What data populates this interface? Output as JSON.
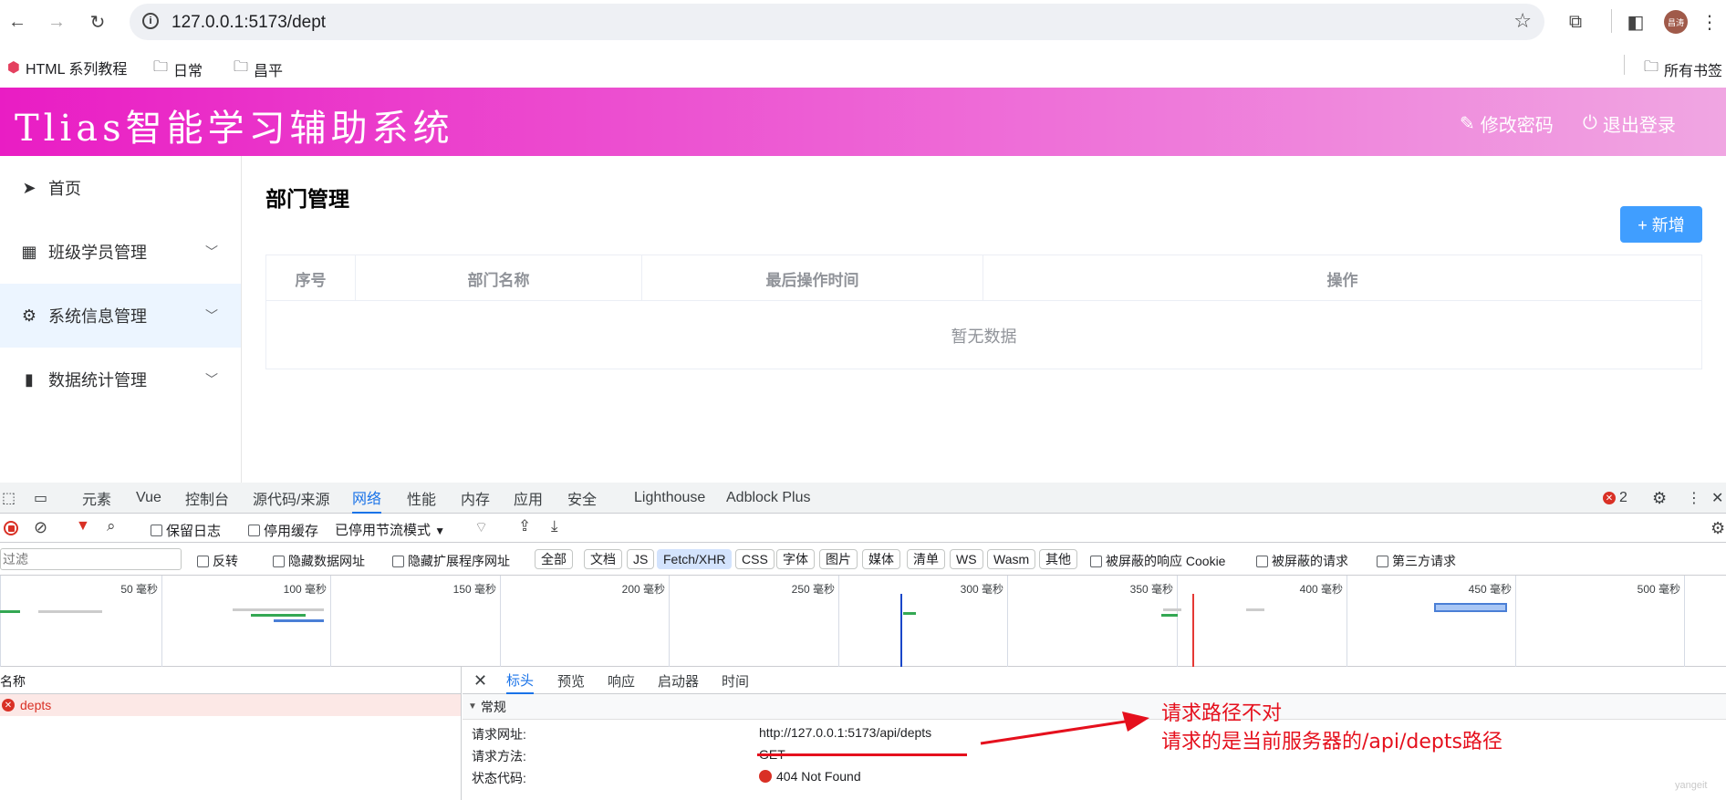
{
  "browser": {
    "url": "127.0.0.1:5173/dept",
    "bookmarks": [
      "HTML 系列教程",
      "日常",
      "昌平"
    ],
    "all_bookmarks": "所有书签",
    "avatar_text": "昌涛"
  },
  "app": {
    "title": "Tlias智能学习辅助系统",
    "change_password": "修改密码",
    "logout": "退出登录"
  },
  "sidebar": {
    "items": [
      {
        "label": "首页",
        "icon": "send-icon"
      },
      {
        "label": "班级学员管理",
        "icon": "grid-icon"
      },
      {
        "label": "系统信息管理",
        "icon": "gear-icon"
      },
      {
        "label": "数据统计管理",
        "icon": "bar-chart-icon"
      }
    ]
  },
  "main": {
    "page_title": "部门管理",
    "add_button": "+ 新增",
    "columns": [
      "序号",
      "部门名称",
      "最后操作时间",
      "操作"
    ],
    "empty_text": "暂无数据"
  },
  "devtools": {
    "tabs": [
      "元素",
      "Vue",
      "控制台",
      "源代码/来源",
      "网络",
      "性能",
      "内存",
      "应用",
      "安全",
      "Lighthouse",
      "Adblock Plus"
    ],
    "active_tab": "网络",
    "error_count": "2",
    "toolbar": {
      "preserve_log": "保留日志",
      "disable_cache": "停用缓存",
      "throttle": "已停用节流模式"
    },
    "filter": {
      "placeholder": "过滤",
      "invert": "反转",
      "hide_data_urls": "隐藏数据网址",
      "hide_ext_urls": "隐藏扩展程序网址",
      "types": [
        "全部",
        "文档",
        "JS",
        "Fetch/XHR",
        "CSS",
        "字体",
        "图片",
        "媒体",
        "清单",
        "WS",
        "Wasm",
        "其他"
      ],
      "active_type": "Fetch/XHR",
      "blocked_cookies": "被屏蔽的响应 Cookie",
      "blocked_requests": "被屏蔽的请求",
      "third_party": "第三方请求"
    },
    "timeline_ticks": [
      "50 毫秒",
      "100 毫秒",
      "150 毫秒",
      "200 毫秒",
      "250 毫秒",
      "300 毫秒",
      "350 毫秒",
      "400 毫秒",
      "450 毫秒",
      "500 毫秒"
    ],
    "list_header": "名称",
    "request_name": "depts",
    "detail_tabs": [
      "标头",
      "预览",
      "响应",
      "启动器",
      "时间"
    ],
    "section": "常规",
    "general": {
      "url_label": "请求网址:",
      "url_value": "http://127.0.0.1:5173/api/depts",
      "method_label": "请求方法:",
      "method_value": "GET",
      "status_label": "状态代码:",
      "status_value": "404 Not Found"
    }
  },
  "annotation": {
    "line1": "请求路径不对",
    "line2": "请求的是当前服务器的/api/depts路径",
    "watermark": "yangeit"
  }
}
